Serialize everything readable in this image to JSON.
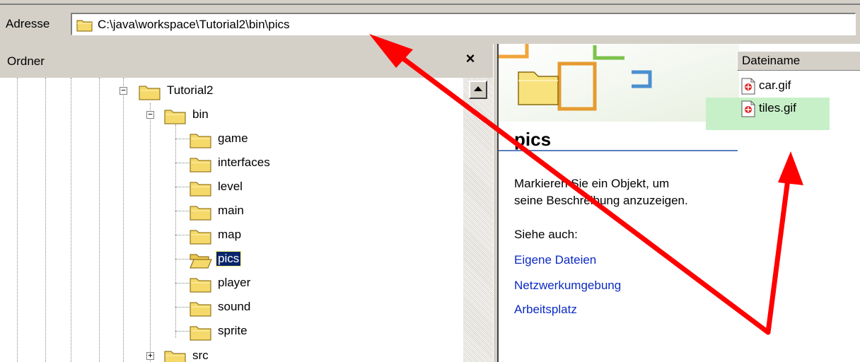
{
  "address": {
    "label": "Adresse",
    "path": "C:\\java\\workspace\\Tutorial2\\bin\\pics"
  },
  "folders_pane": {
    "title": "Ordner",
    "close_symbol": "×",
    "tree": [
      {
        "label": "Tutorial2",
        "expander": "−"
      },
      {
        "label": "bin",
        "expander": "−"
      },
      {
        "label": "game"
      },
      {
        "label": "interfaces"
      },
      {
        "label": "level"
      },
      {
        "label": "main"
      },
      {
        "label": "map"
      },
      {
        "label": "pics",
        "selected": true
      },
      {
        "label": "player"
      },
      {
        "label": "sound"
      },
      {
        "label": "sprite"
      },
      {
        "label": "src",
        "expander": "+"
      }
    ]
  },
  "details": {
    "folder_name": "pics",
    "description_line1": "Markieren Sie ein Objekt, um",
    "description_line2": "seine Beschreibung anzuzeigen.",
    "see_also": "Siehe auch:",
    "links": [
      "Eigene Dateien",
      "Netzwerkumgebung",
      "Arbeitsplatz"
    ]
  },
  "file_list": {
    "column": "Dateiname",
    "files": [
      {
        "name": "car.gif"
      },
      {
        "name": "tiles.gif",
        "highlighted": true
      }
    ]
  },
  "colors": {
    "selection": "#0a246a",
    "link": "#0c2ac4",
    "annotation_arrow": "#ff0000",
    "highlight": "#c8f0c8"
  }
}
